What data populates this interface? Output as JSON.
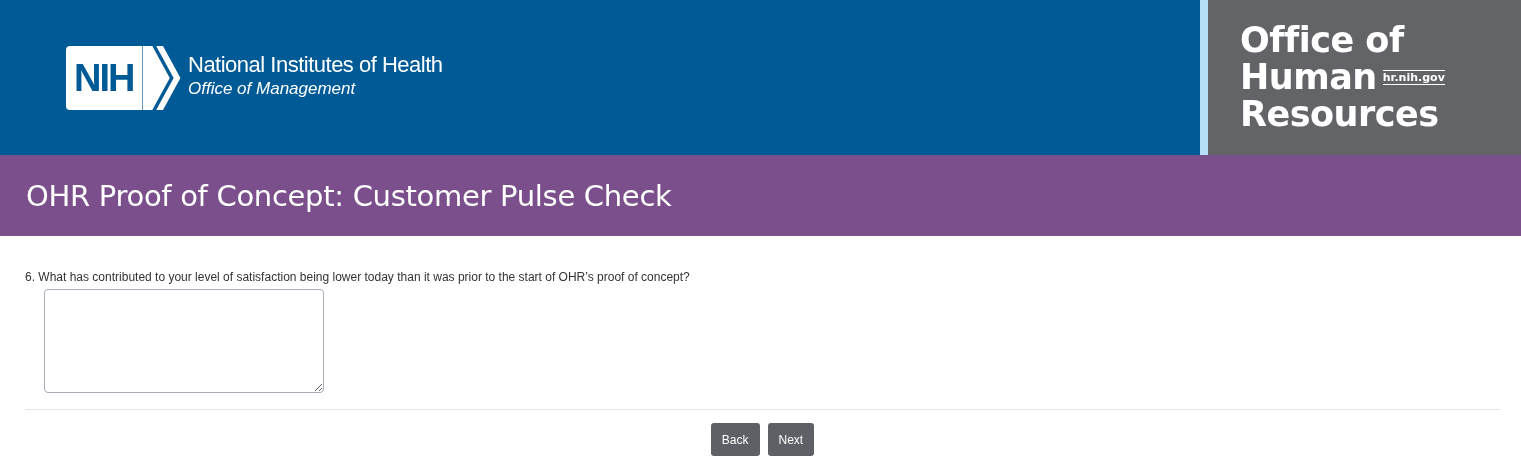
{
  "header": {
    "logo_mark": "NIH",
    "org_name": "National Institutes of Health",
    "org_sub": "Office of Management",
    "office_lines": [
      "Office of",
      "Human",
      "Resources"
    ],
    "office_url": "hr.nih.gov"
  },
  "title": "OHR Proof of Concept: Customer Pulse Check",
  "question": {
    "label": "6. What has contributed to your level of satisfaction being lower today than it was prior to the start of OHR’s proof of concept?"
  },
  "buttons": [
    "Back",
    "Next"
  ]
}
